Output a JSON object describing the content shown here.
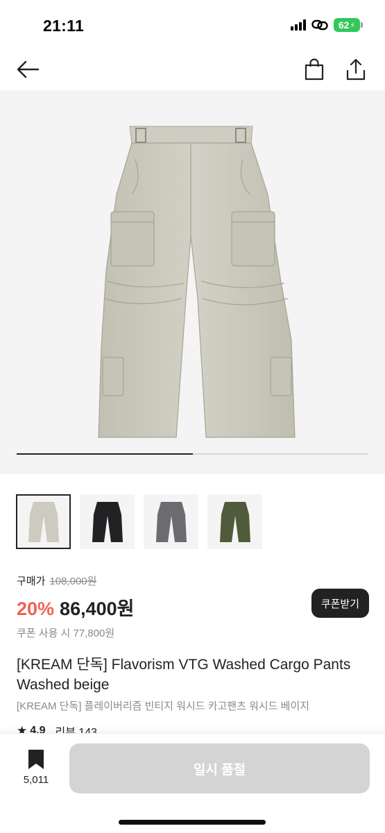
{
  "status_bar": {
    "time": "21:11",
    "battery": "62"
  },
  "nav": {
    "icons": [
      "arrow-left-icon",
      "shopping-bag-icon",
      "share-icon"
    ]
  },
  "gallery": {
    "progress": 0.5,
    "thumbnails": [
      {
        "color": "#cdcbbf",
        "selected": true
      },
      {
        "color": "#222224",
        "selected": false
      },
      {
        "color": "#6c6c70",
        "selected": false
      },
      {
        "color": "#4f5b3a",
        "selected": false
      }
    ]
  },
  "price": {
    "purchase_label": "구매가",
    "original_price": "108,000원",
    "discount": "20%",
    "sale_price": "86,400원",
    "coupon_price": "쿠폰 사용 시 77,800원",
    "coupon_button": "쿠폰받기"
  },
  "product": {
    "name": "[KREAM 단독] Flavorism VTG Washed Cargo Pants Washed beige",
    "name_ko": "[KREAM 단독] 플레이버리즘 빈티지 워시드 카고팬츠 워시드 베이지",
    "rating": "4.9",
    "review": "리뷰 143"
  },
  "bottom_bar": {
    "bookmark_count": "5,011",
    "action_label": "일시 품절"
  },
  "colors": {
    "discount": "#ef6253",
    "primary": "#222222",
    "disabled_button": "#d4d4d4",
    "battery": "#34c759"
  }
}
